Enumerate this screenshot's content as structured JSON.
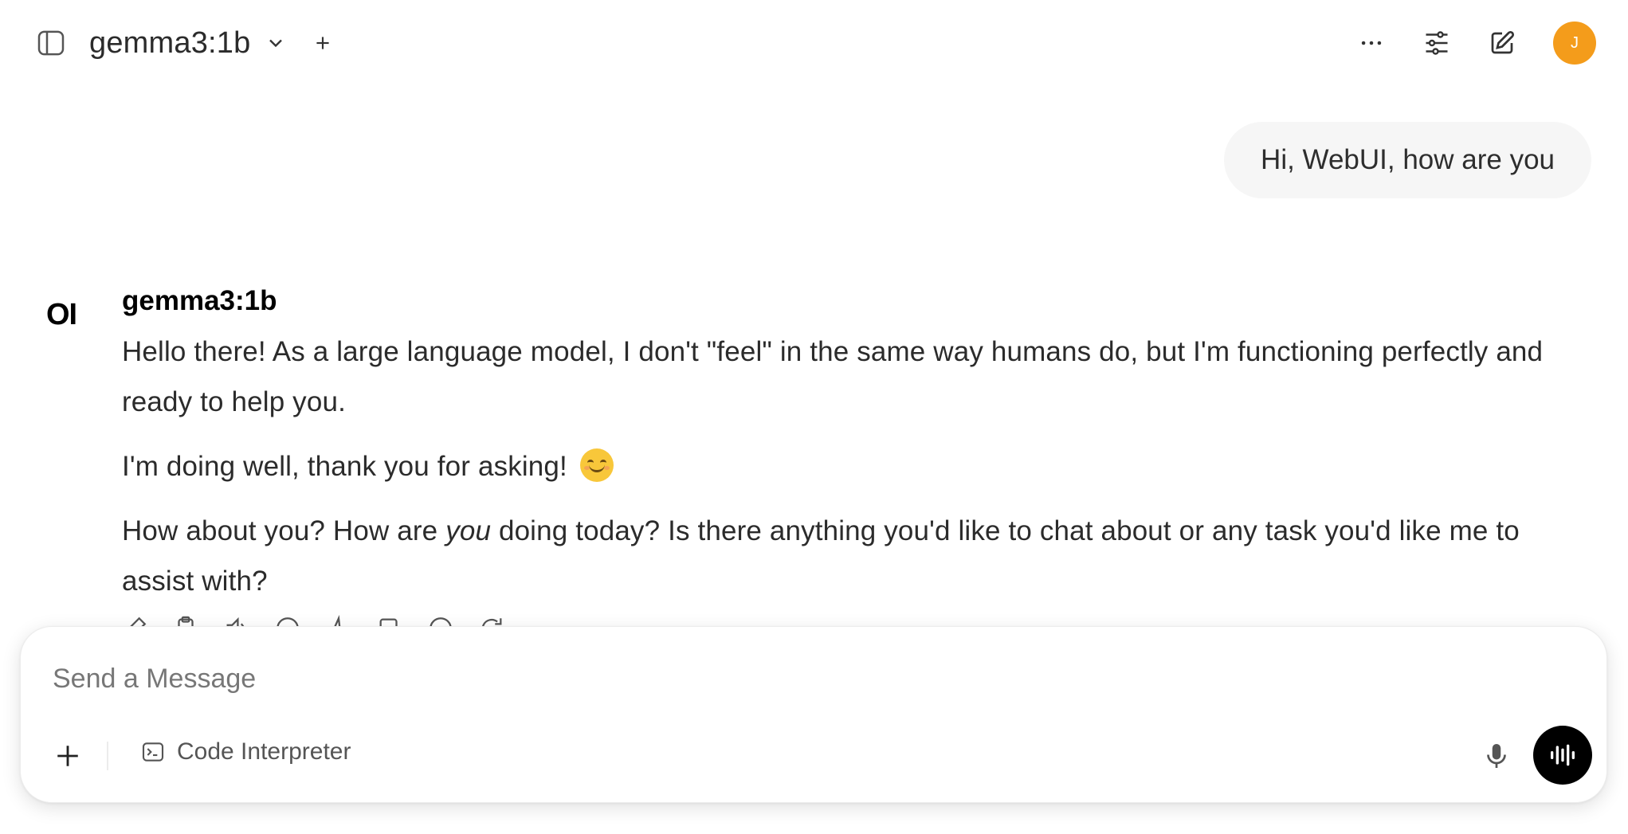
{
  "header": {
    "model_name": "gemma3:1b",
    "avatar_initial": "J",
    "avatar_color": "#f49c1b",
    "icons": [
      "sidebar-toggle-icon",
      "chevron-down-icon",
      "plus-icon",
      "ellipsis-icon",
      "sliders-icon",
      "edit-icon"
    ]
  },
  "messages": {
    "user": "Hi, WebUI, how are you",
    "assistant": {
      "logo": "OI",
      "name": "gemma3:1b",
      "p1": "Hello there! As a large language model, I don't \"feel\" in the same way humans do, but I'm functioning perfectly and ready to help you.",
      "p2": "I'm doing well, thank you for asking!",
      "p2_emoji": "smiling-face-emoji",
      "p3_before": "How about you? How are ",
      "p3_em": "you",
      "p3_after": " doing today? Is there anything you'd like to chat about or any task you'd like me to assist with?"
    },
    "actions": [
      "edit-icon",
      "copy-icon",
      "read-aloud-icon",
      "info-icon",
      "thumbs-up-icon",
      "thumbs-down-icon",
      "continue-icon",
      "regenerate-icon"
    ]
  },
  "composer": {
    "placeholder": "Send a Message",
    "value": "",
    "code_interpreter_label": "Code Interpreter"
  }
}
